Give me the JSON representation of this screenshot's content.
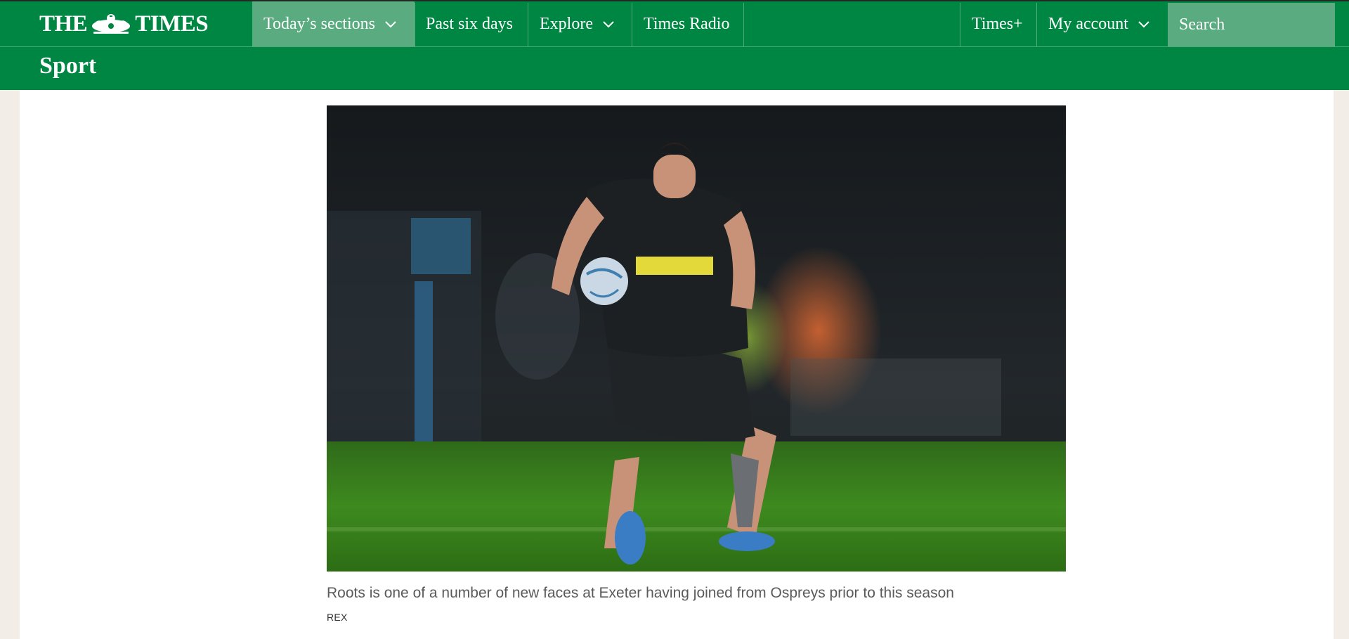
{
  "header": {
    "logo_left": "THE",
    "logo_right": "TIMES",
    "nav": [
      {
        "label": "Today’s sections",
        "has_dropdown": true,
        "active": true
      },
      {
        "label": "Past six days",
        "has_dropdown": false,
        "active": false
      },
      {
        "label": "Explore",
        "has_dropdown": true,
        "active": false
      },
      {
        "label": "Times Radio",
        "has_dropdown": false,
        "active": false
      }
    ],
    "right_nav": [
      {
        "label": "Times+",
        "has_dropdown": false
      },
      {
        "label": "My account",
        "has_dropdown": true
      }
    ],
    "search": {
      "placeholder": "Search",
      "icon": "search-icon"
    },
    "colors": {
      "brand_green": "#008643",
      "active_tab": "#5aac80"
    }
  },
  "section": {
    "title": "Sport"
  },
  "article": {
    "image_alt": "Roots is one of a number of new faces at Exeter having joined from Ospreys prior to this season",
    "caption": "Roots is one of a number of new faces at Exeter having joined from Ospreys prior to this season",
    "credit": "REX"
  }
}
